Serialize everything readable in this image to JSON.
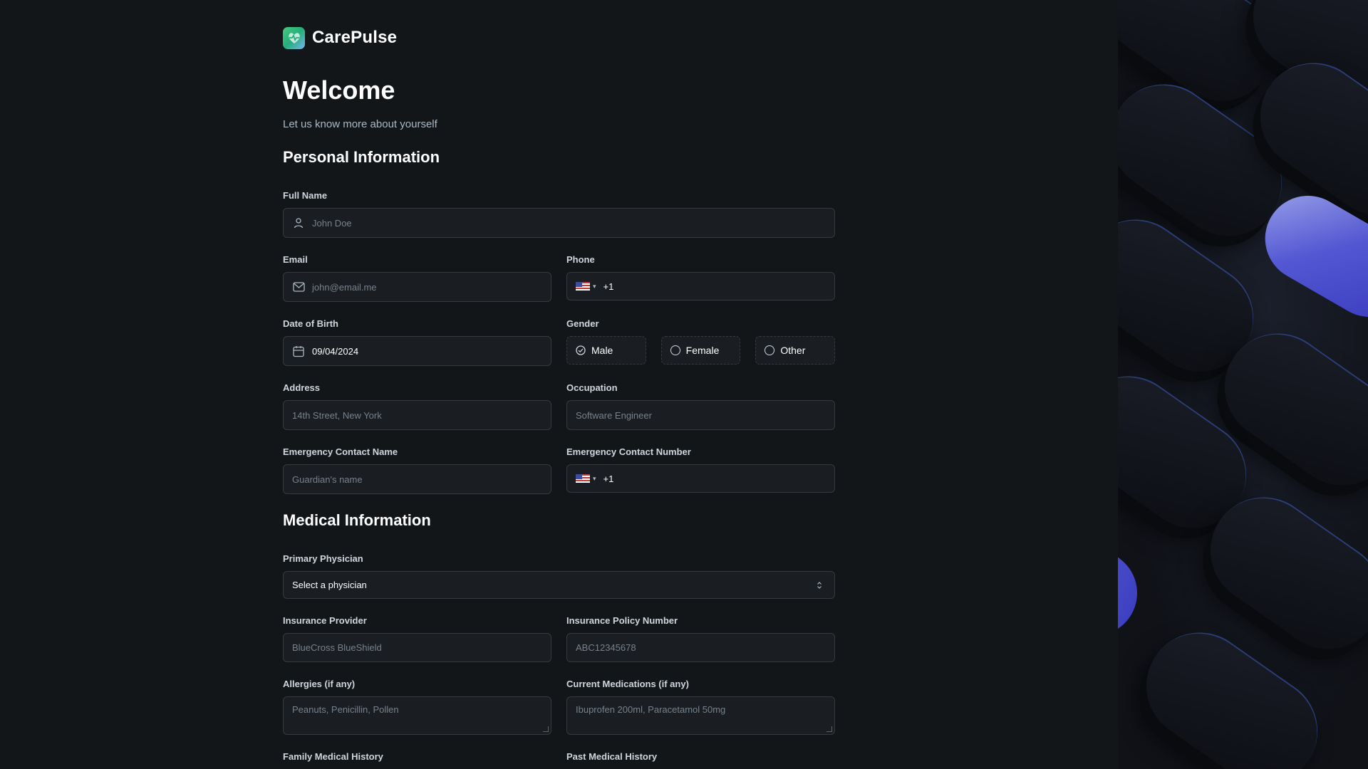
{
  "brand": {
    "name": "CarePulse"
  },
  "header": {
    "title": "Welcome",
    "subtitle": "Let us know more about yourself"
  },
  "sections": {
    "personal": "Personal Information",
    "medical": "Medical Information"
  },
  "fields": {
    "full_name": {
      "label": "Full Name",
      "placeholder": "John Doe"
    },
    "email": {
      "label": "Email",
      "placeholder": "john@email.me"
    },
    "phone": {
      "label": "Phone",
      "value": "+1"
    },
    "dob": {
      "label": "Date of Birth",
      "value": "09/04/2024"
    },
    "gender": {
      "label": "Gender",
      "options": [
        "Male",
        "Female",
        "Other"
      ],
      "selected": "Male"
    },
    "address": {
      "label": "Address",
      "placeholder": "14th Street, New York"
    },
    "occupation": {
      "label": "Occupation",
      "placeholder": "Software Engineer"
    },
    "emergency_name": {
      "label": "Emergency Contact Name",
      "placeholder": "Guardian's name"
    },
    "emergency_number": {
      "label": "Emergency Contact Number",
      "value": "+1"
    },
    "physician": {
      "label": "Primary Physician",
      "value": "Select a physician"
    },
    "insurance_provider": {
      "label": "Insurance Provider",
      "placeholder": "BlueCross BlueShield"
    },
    "insurance_policy": {
      "label": "Insurance Policy Number",
      "placeholder": "ABC12345678"
    },
    "allergies": {
      "label": "Allergies (if any)",
      "placeholder": "Peanuts, Penicillin, Pollen"
    },
    "medications": {
      "label": "Current Medications (if any)",
      "placeholder": "Ibuprofen 200ml, Paracetamol 50mg"
    },
    "family_history": {
      "label": "Family Medical History"
    },
    "past_history": {
      "label": "Past Medical History"
    }
  },
  "icons": {
    "logo": "carepulse-logo-icon",
    "user": "user-icon",
    "mail": "mail-icon",
    "calendar": "calendar-icon",
    "flag": "us-flag-icon",
    "select": "chevron-updown-icon"
  },
  "colors": {
    "background": "#131619",
    "input_bg": "#1a1d21",
    "border": "#363a3d",
    "accent": "#24ae7c",
    "hero_accent": "#5a5ee6"
  }
}
